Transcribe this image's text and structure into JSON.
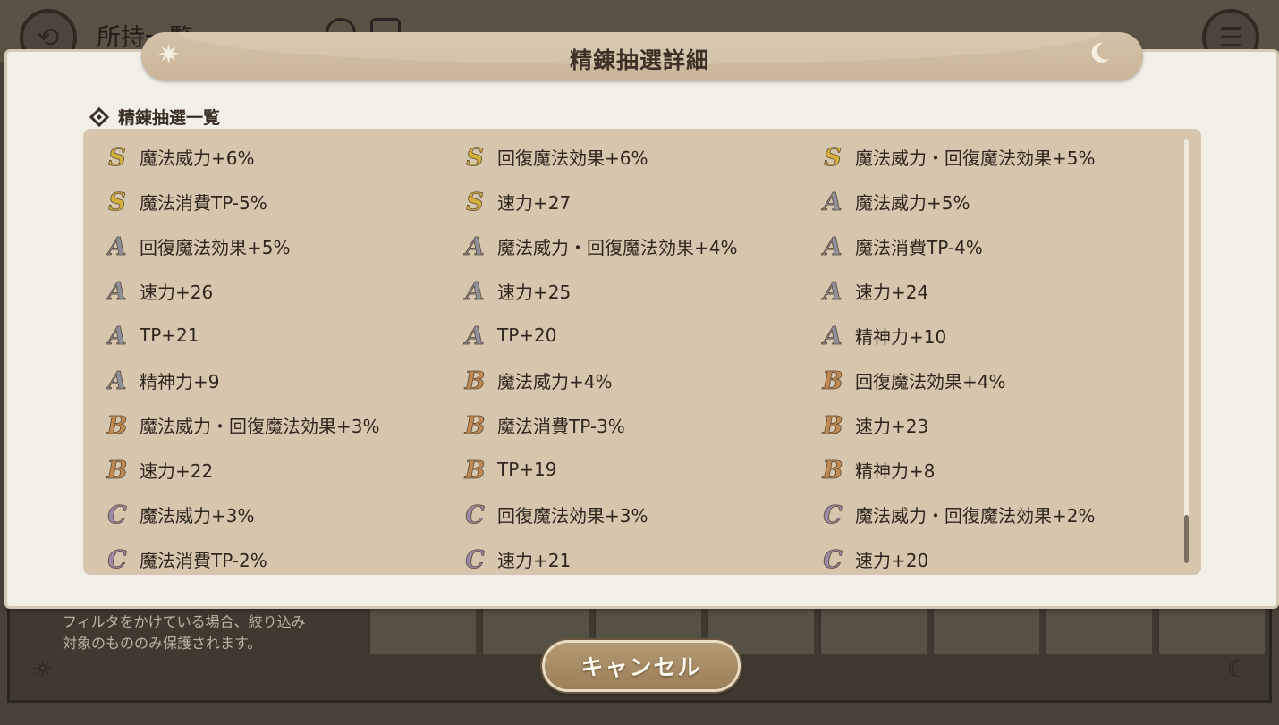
{
  "background": {
    "title": "所持一覧",
    "note_line1": "フィルタをかけている場合、絞り込み",
    "note_line2": "対象のもののみ保護されます。"
  },
  "modal": {
    "title": "精錬抽選詳細",
    "section_label": "精錬抽選一覧"
  },
  "colors": {
    "S": "#d4b23a",
    "A": "#8f8f99",
    "B": "#c08a52",
    "C": "#9b8aa8"
  },
  "icons": {
    "S": "rank-s-icon",
    "A": "rank-a-icon",
    "B": "rank-b-icon",
    "C": "rank-c-icon"
  },
  "entries": [
    [
      {
        "rank": "S",
        "text": "魔法威力+6%"
      },
      {
        "rank": "S",
        "text": "回復魔法効果+6%"
      },
      {
        "rank": "S",
        "text": "魔法威力・回復魔法効果+5%"
      }
    ],
    [
      {
        "rank": "S",
        "text": "魔法消費TP-5%"
      },
      {
        "rank": "S",
        "text": "速力+27"
      },
      {
        "rank": "A",
        "text": "魔法威力+5%"
      }
    ],
    [
      {
        "rank": "A",
        "text": "回復魔法効果+5%"
      },
      {
        "rank": "A",
        "text": "魔法威力・回復魔法効果+4%"
      },
      {
        "rank": "A",
        "text": "魔法消費TP-4%"
      }
    ],
    [
      {
        "rank": "A",
        "text": "速力+26"
      },
      {
        "rank": "A",
        "text": "速力+25"
      },
      {
        "rank": "A",
        "text": "速力+24"
      }
    ],
    [
      {
        "rank": "A",
        "text": "TP+21"
      },
      {
        "rank": "A",
        "text": "TP+20"
      },
      {
        "rank": "A",
        "text": "精神力+10"
      }
    ],
    [
      {
        "rank": "A",
        "text": "精神力+9"
      },
      {
        "rank": "B",
        "text": "魔法威力+4%"
      },
      {
        "rank": "B",
        "text": "回復魔法効果+4%"
      }
    ],
    [
      {
        "rank": "B",
        "text": "魔法威力・回復魔法効果+3%"
      },
      {
        "rank": "B",
        "text": "魔法消費TP-3%"
      },
      {
        "rank": "B",
        "text": "速力+23"
      }
    ],
    [
      {
        "rank": "B",
        "text": "速力+22"
      },
      {
        "rank": "B",
        "text": "TP+19"
      },
      {
        "rank": "B",
        "text": "精神力+8"
      }
    ],
    [
      {
        "rank": "C",
        "text": "魔法威力+3%"
      },
      {
        "rank": "C",
        "text": "回復魔法効果+3%"
      },
      {
        "rank": "C",
        "text": "魔法威力・回復魔法効果+2%"
      }
    ],
    [
      {
        "rank": "C",
        "text": "魔法消費TP-2%"
      },
      {
        "rank": "C",
        "text": "速力+21"
      },
      {
        "rank": "C",
        "text": "速力+20"
      }
    ]
  ],
  "cancel_button": {
    "label": "キャンセル"
  },
  "scroll": {
    "position": 0.92
  }
}
